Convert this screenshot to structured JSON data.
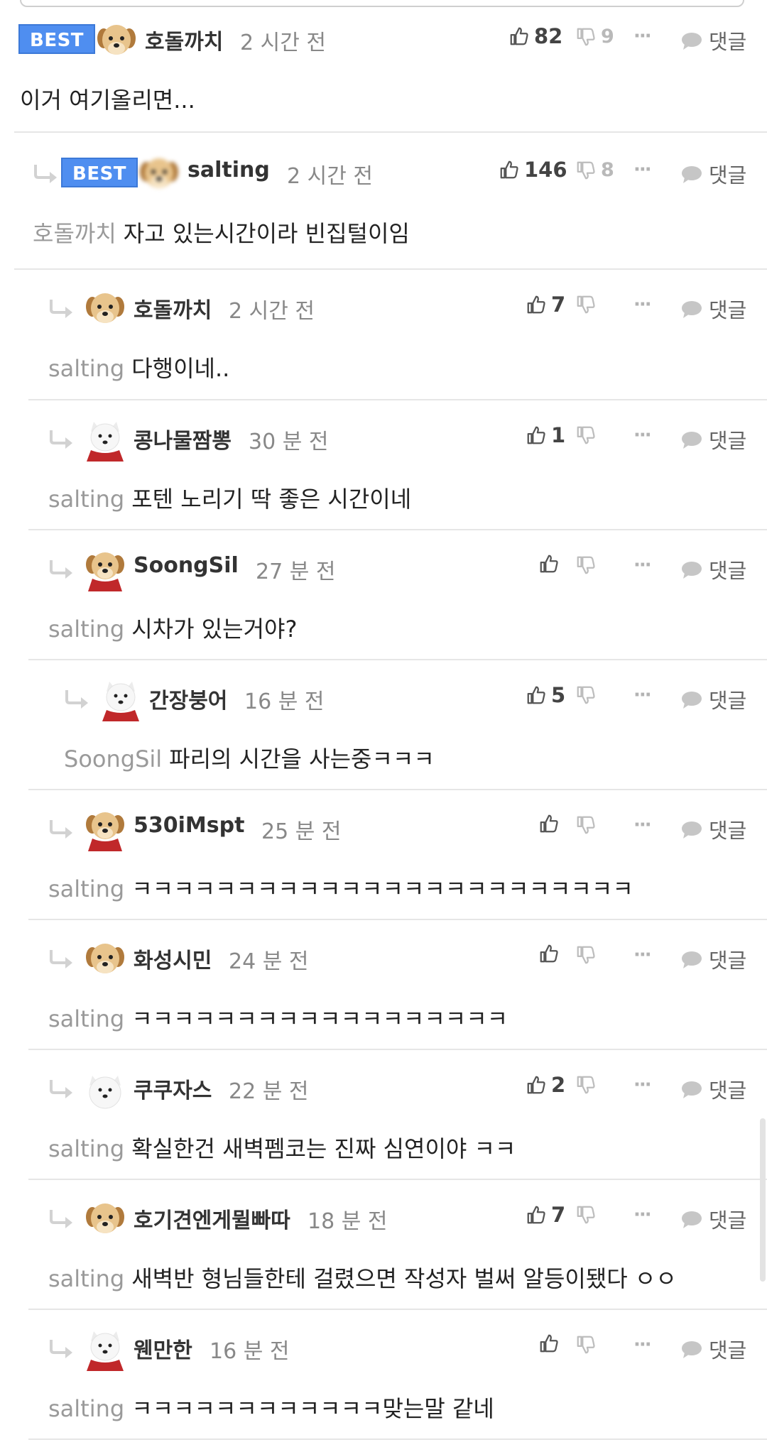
{
  "reply_label": "댓글",
  "best_label": "BEST",
  "more_label": "···",
  "colors": {
    "accent": "#4f8ef0",
    "muted": "#888888",
    "divider": "#e6e6e6"
  },
  "comments": [
    {
      "user": "호돌까치",
      "time": "2 시간 전",
      "likes": "82",
      "dislikes": "9",
      "mention": "",
      "text": "이거 여기올리면...",
      "best": true,
      "avatar": "puppy"
    },
    {
      "user": "salting",
      "time": "2 시간 전",
      "likes": "146",
      "dislikes": "8",
      "mention": "호돌까치",
      "text": "자고 있는시간이라 빈집털이임",
      "best": true,
      "avatar": "puppy-blurred"
    },
    {
      "user": "호돌까치",
      "time": "2 시간 전",
      "likes": "7",
      "dislikes": "",
      "mention": "salting",
      "text": "다행이네..",
      "best": false,
      "avatar": "puppy"
    },
    {
      "user": "콩나물짬뽕",
      "time": "30 분 전",
      "likes": "1",
      "dislikes": "",
      "mention": "salting",
      "text": "포텐 노리기 딱 좋은 시간이네",
      "best": false,
      "avatar": "white-dog-scarf"
    },
    {
      "user": "SoongSil",
      "time": "27 분 전",
      "likes": "",
      "dislikes": "",
      "mention": "salting",
      "text": "시차가 있는거야?",
      "best": false,
      "avatar": "puppy-scarf"
    },
    {
      "user": "간장붕어",
      "time": "16 분 전",
      "likes": "5",
      "dislikes": "",
      "mention": "SoongSil",
      "text": "파리의 시간을 사는중ㅋㅋㅋ",
      "best": false,
      "avatar": "white-dog-scarf"
    },
    {
      "user": "530iMspt",
      "time": "25 분 전",
      "likes": "",
      "dislikes": "",
      "mention": "salting",
      "text": "ㅋㅋㅋㅋㅋㅋㅋㅋㅋㅋㅋㅋㅋㅋㅋㅋㅋㅋㅋㅋㅋㅋㅋㅋ",
      "best": false,
      "avatar": "puppy-scarf"
    },
    {
      "user": "화성시민",
      "time": "24 분 전",
      "likes": "",
      "dislikes": "",
      "mention": "salting",
      "text": "ㅋㅋㅋㅋㅋㅋㅋㅋㅋㅋㅋㅋㅋㅋㅋㅋㅋㅋ",
      "best": false,
      "avatar": "puppy"
    },
    {
      "user": "쿠쿠자스",
      "time": "22 분 전",
      "likes": "2",
      "dislikes": "",
      "mention": "salting",
      "text": "확실한건 새벽펨코는 진짜 심연이야 ㅋㅋ",
      "best": false,
      "avatar": "white-dog"
    },
    {
      "user": "호기견엔게뮐빠따",
      "time": "18 분 전",
      "likes": "7",
      "dislikes": "",
      "mention": "salting",
      "text": "새벽반 형님들한테 걸렸으면 작성자 벌써 알등이됐다 ㅇㅇ",
      "best": false,
      "avatar": "puppy"
    },
    {
      "user": "웬만한",
      "time": "16 분 전",
      "likes": "",
      "dislikes": "",
      "mention": "salting",
      "text": "ㅋㅋㅋㅋㅋㅋㅋㅋㅋㅋㅋㅋ맞는말 같네",
      "best": false,
      "avatar": "white-dog-scarf"
    }
  ]
}
